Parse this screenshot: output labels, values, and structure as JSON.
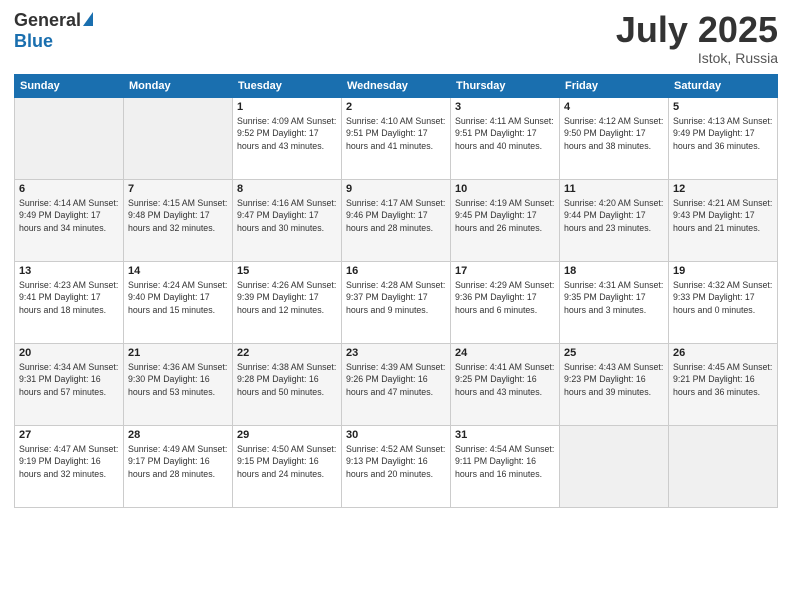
{
  "header": {
    "logo_general": "General",
    "logo_blue": "Blue",
    "month_title": "July 2025",
    "location": "Istok, Russia"
  },
  "columns": [
    "Sunday",
    "Monday",
    "Tuesday",
    "Wednesday",
    "Thursday",
    "Friday",
    "Saturday"
  ],
  "weeks": [
    [
      {
        "day": "",
        "detail": ""
      },
      {
        "day": "",
        "detail": ""
      },
      {
        "day": "1",
        "detail": "Sunrise: 4:09 AM\nSunset: 9:52 PM\nDaylight: 17 hours\nand 43 minutes."
      },
      {
        "day": "2",
        "detail": "Sunrise: 4:10 AM\nSunset: 9:51 PM\nDaylight: 17 hours\nand 41 minutes."
      },
      {
        "day": "3",
        "detail": "Sunrise: 4:11 AM\nSunset: 9:51 PM\nDaylight: 17 hours\nand 40 minutes."
      },
      {
        "day": "4",
        "detail": "Sunrise: 4:12 AM\nSunset: 9:50 PM\nDaylight: 17 hours\nand 38 minutes."
      },
      {
        "day": "5",
        "detail": "Sunrise: 4:13 AM\nSunset: 9:49 PM\nDaylight: 17 hours\nand 36 minutes."
      }
    ],
    [
      {
        "day": "6",
        "detail": "Sunrise: 4:14 AM\nSunset: 9:49 PM\nDaylight: 17 hours\nand 34 minutes."
      },
      {
        "day": "7",
        "detail": "Sunrise: 4:15 AM\nSunset: 9:48 PM\nDaylight: 17 hours\nand 32 minutes."
      },
      {
        "day": "8",
        "detail": "Sunrise: 4:16 AM\nSunset: 9:47 PM\nDaylight: 17 hours\nand 30 minutes."
      },
      {
        "day": "9",
        "detail": "Sunrise: 4:17 AM\nSunset: 9:46 PM\nDaylight: 17 hours\nand 28 minutes."
      },
      {
        "day": "10",
        "detail": "Sunrise: 4:19 AM\nSunset: 9:45 PM\nDaylight: 17 hours\nand 26 minutes."
      },
      {
        "day": "11",
        "detail": "Sunrise: 4:20 AM\nSunset: 9:44 PM\nDaylight: 17 hours\nand 23 minutes."
      },
      {
        "day": "12",
        "detail": "Sunrise: 4:21 AM\nSunset: 9:43 PM\nDaylight: 17 hours\nand 21 minutes."
      }
    ],
    [
      {
        "day": "13",
        "detail": "Sunrise: 4:23 AM\nSunset: 9:41 PM\nDaylight: 17 hours\nand 18 minutes."
      },
      {
        "day": "14",
        "detail": "Sunrise: 4:24 AM\nSunset: 9:40 PM\nDaylight: 17 hours\nand 15 minutes."
      },
      {
        "day": "15",
        "detail": "Sunrise: 4:26 AM\nSunset: 9:39 PM\nDaylight: 17 hours\nand 12 minutes."
      },
      {
        "day": "16",
        "detail": "Sunrise: 4:28 AM\nSunset: 9:37 PM\nDaylight: 17 hours\nand 9 minutes."
      },
      {
        "day": "17",
        "detail": "Sunrise: 4:29 AM\nSunset: 9:36 PM\nDaylight: 17 hours\nand 6 minutes."
      },
      {
        "day": "18",
        "detail": "Sunrise: 4:31 AM\nSunset: 9:35 PM\nDaylight: 17 hours\nand 3 minutes."
      },
      {
        "day": "19",
        "detail": "Sunrise: 4:32 AM\nSunset: 9:33 PM\nDaylight: 17 hours\nand 0 minutes."
      }
    ],
    [
      {
        "day": "20",
        "detail": "Sunrise: 4:34 AM\nSunset: 9:31 PM\nDaylight: 16 hours\nand 57 minutes."
      },
      {
        "day": "21",
        "detail": "Sunrise: 4:36 AM\nSunset: 9:30 PM\nDaylight: 16 hours\nand 53 minutes."
      },
      {
        "day": "22",
        "detail": "Sunrise: 4:38 AM\nSunset: 9:28 PM\nDaylight: 16 hours\nand 50 minutes."
      },
      {
        "day": "23",
        "detail": "Sunrise: 4:39 AM\nSunset: 9:26 PM\nDaylight: 16 hours\nand 47 minutes."
      },
      {
        "day": "24",
        "detail": "Sunrise: 4:41 AM\nSunset: 9:25 PM\nDaylight: 16 hours\nand 43 minutes."
      },
      {
        "day": "25",
        "detail": "Sunrise: 4:43 AM\nSunset: 9:23 PM\nDaylight: 16 hours\nand 39 minutes."
      },
      {
        "day": "26",
        "detail": "Sunrise: 4:45 AM\nSunset: 9:21 PM\nDaylight: 16 hours\nand 36 minutes."
      }
    ],
    [
      {
        "day": "27",
        "detail": "Sunrise: 4:47 AM\nSunset: 9:19 PM\nDaylight: 16 hours\nand 32 minutes."
      },
      {
        "day": "28",
        "detail": "Sunrise: 4:49 AM\nSunset: 9:17 PM\nDaylight: 16 hours\nand 28 minutes."
      },
      {
        "day": "29",
        "detail": "Sunrise: 4:50 AM\nSunset: 9:15 PM\nDaylight: 16 hours\nand 24 minutes."
      },
      {
        "day": "30",
        "detail": "Sunrise: 4:52 AM\nSunset: 9:13 PM\nDaylight: 16 hours\nand 20 minutes."
      },
      {
        "day": "31",
        "detail": "Sunrise: 4:54 AM\nSunset: 9:11 PM\nDaylight: 16 hours\nand 16 minutes."
      },
      {
        "day": "",
        "detail": ""
      },
      {
        "day": "",
        "detail": ""
      }
    ]
  ]
}
